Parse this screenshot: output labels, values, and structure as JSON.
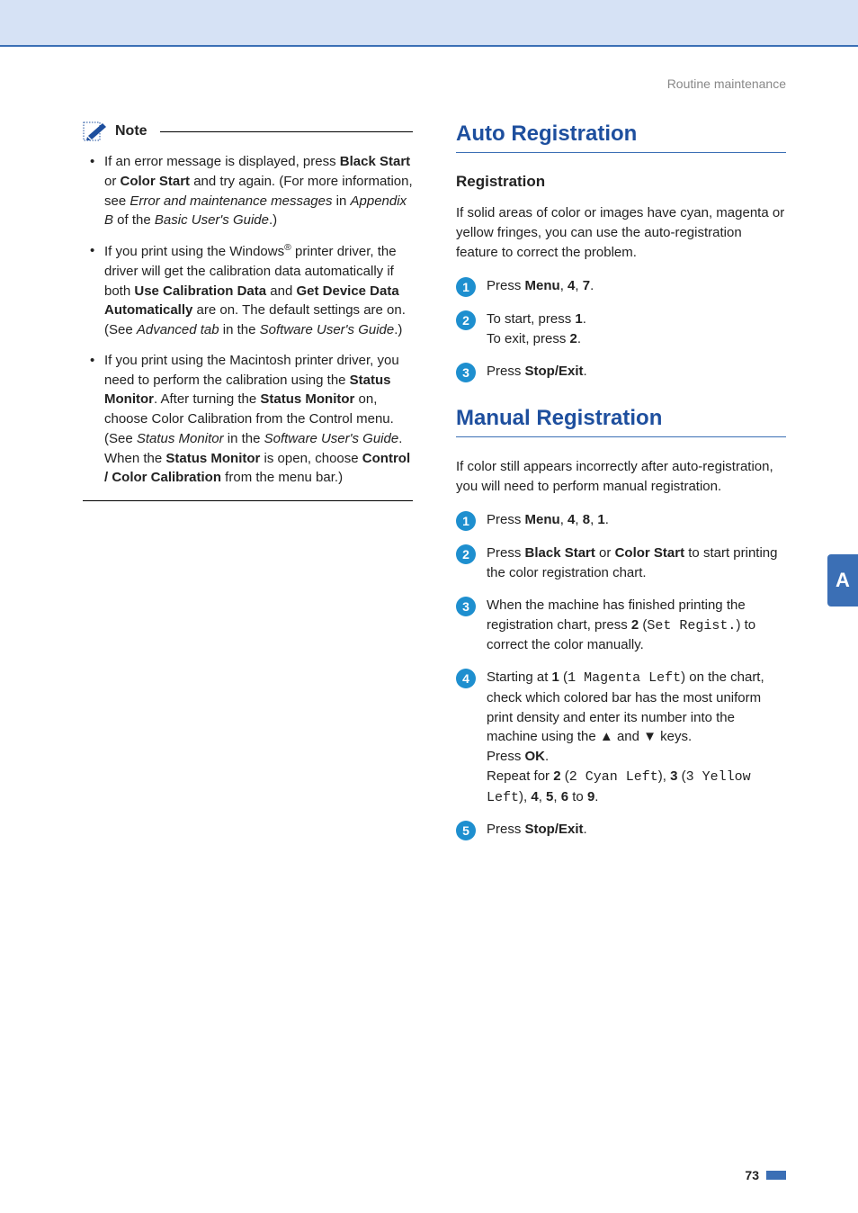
{
  "header": {
    "section": "Routine maintenance"
  },
  "sideTab": "A",
  "pageNumber": "73",
  "note": {
    "title": "Note",
    "items": [
      {
        "pre1": "If an error message is displayed, press ",
        "b1": "Black Start",
        "mid1": " or ",
        "b2": "Color Start",
        "mid2": " and try again. (For more information, see ",
        "i1": "Error and maintenance messages",
        "mid3": " in ",
        "i2": "Appendix B",
        "mid4": " of the ",
        "i3": "Basic User's Guide",
        "post": ".)"
      },
      {
        "pre1": "If you print using the Windows",
        "sup": "®",
        "mid1": " printer driver, the driver will get the calibration data automatically if both ",
        "b1": "Use Calibration Data",
        "mid2": " and ",
        "b2": "Get Device Data Automatically",
        "mid3": " are on. The default settings are on. (See ",
        "i1": "Advanced tab",
        "mid4": " in the ",
        "i2": "Software User's Guide",
        "post": ".)"
      },
      {
        "pre1": "If you print using the Macintosh printer driver, you need to perform the calibration using the ",
        "b1": "Status Monitor",
        "mid1": ". After turning the ",
        "b2": "Status Monitor",
        "mid2": " on, choose Color Calibration from the Control menu. (See ",
        "i1": "Status Monitor",
        "mid3": " in the ",
        "i2": "Software User's Guide",
        "mid4": ". When the ",
        "b3": "Status Monitor",
        "mid5": " is open, choose ",
        "b4": "Control / Color Calibration",
        "post": " from the menu bar.)"
      }
    ]
  },
  "auto": {
    "heading": "Auto Registration",
    "sub": "Registration",
    "intro": "If solid areas of color or images have cyan, magenta or yellow fringes, you can use the auto-registration feature to correct the problem.",
    "steps": [
      {
        "n": "1",
        "pre": "Press ",
        "b1": "Menu",
        "mid1": ", ",
        "b2": "4",
        "mid2": ", ",
        "b3": "7",
        "post": "."
      },
      {
        "n": "2",
        "pre": "To start, press ",
        "b1": "1",
        "mid1": ".",
        "br": true,
        "pre2": "To exit, press ",
        "b2": "2",
        "post": "."
      },
      {
        "n": "3",
        "pre": "Press ",
        "b1": "Stop/Exit",
        "post": "."
      }
    ]
  },
  "manual": {
    "heading": "Manual Registration",
    "intro": "If color still appears incorrectly after auto-registration, you will need to perform manual registration.",
    "steps": {
      "s1": {
        "n": "1",
        "pre": "Press ",
        "b1": "Menu",
        "c1": ", ",
        "b2": "4",
        "c2": ", ",
        "b3": "8",
        "c3": ", ",
        "b4": "1",
        "post": "."
      },
      "s2": {
        "n": "2",
        "pre": "Press ",
        "b1": "Black Start",
        "mid": " or ",
        "b2": "Color Start",
        "post": " to start printing the color registration chart."
      },
      "s3": {
        "n": "3",
        "pre": "When the machine has finished printing the registration chart, press ",
        "b1": "2",
        "mid1": " (",
        "m1": "Set Regist.",
        "post": ") to correct the color manually."
      },
      "s4": {
        "n": "4",
        "pre": "Starting at ",
        "b1": "1",
        "mid1": " (",
        "m1": "1 Magenta Left",
        "mid2": ") on the chart, check which colored bar has the most uniform print density and enter its number into the machine using the ",
        "up": "▲",
        "and": " and ",
        "down": "▼",
        "keys": " keys.",
        "pressPre": "Press ",
        "bOK": "OK",
        "pressPost": ".",
        "rep1": "Repeat for ",
        "b2": "2",
        "mid3": " (",
        "m2": "2 Cyan Left",
        "mid4": "), ",
        "b3": "3",
        "mid5": " (",
        "m3": "3 Yellow Left",
        "mid6": "), ",
        "b4": "4",
        "c1": ", ",
        "b5": "5",
        "c2": ", ",
        "b6": "6",
        "to": " to ",
        "b9": "9",
        "post": "."
      },
      "s5": {
        "n": "5",
        "pre": "Press ",
        "b1": "Stop/Exit",
        "post": "."
      }
    }
  }
}
